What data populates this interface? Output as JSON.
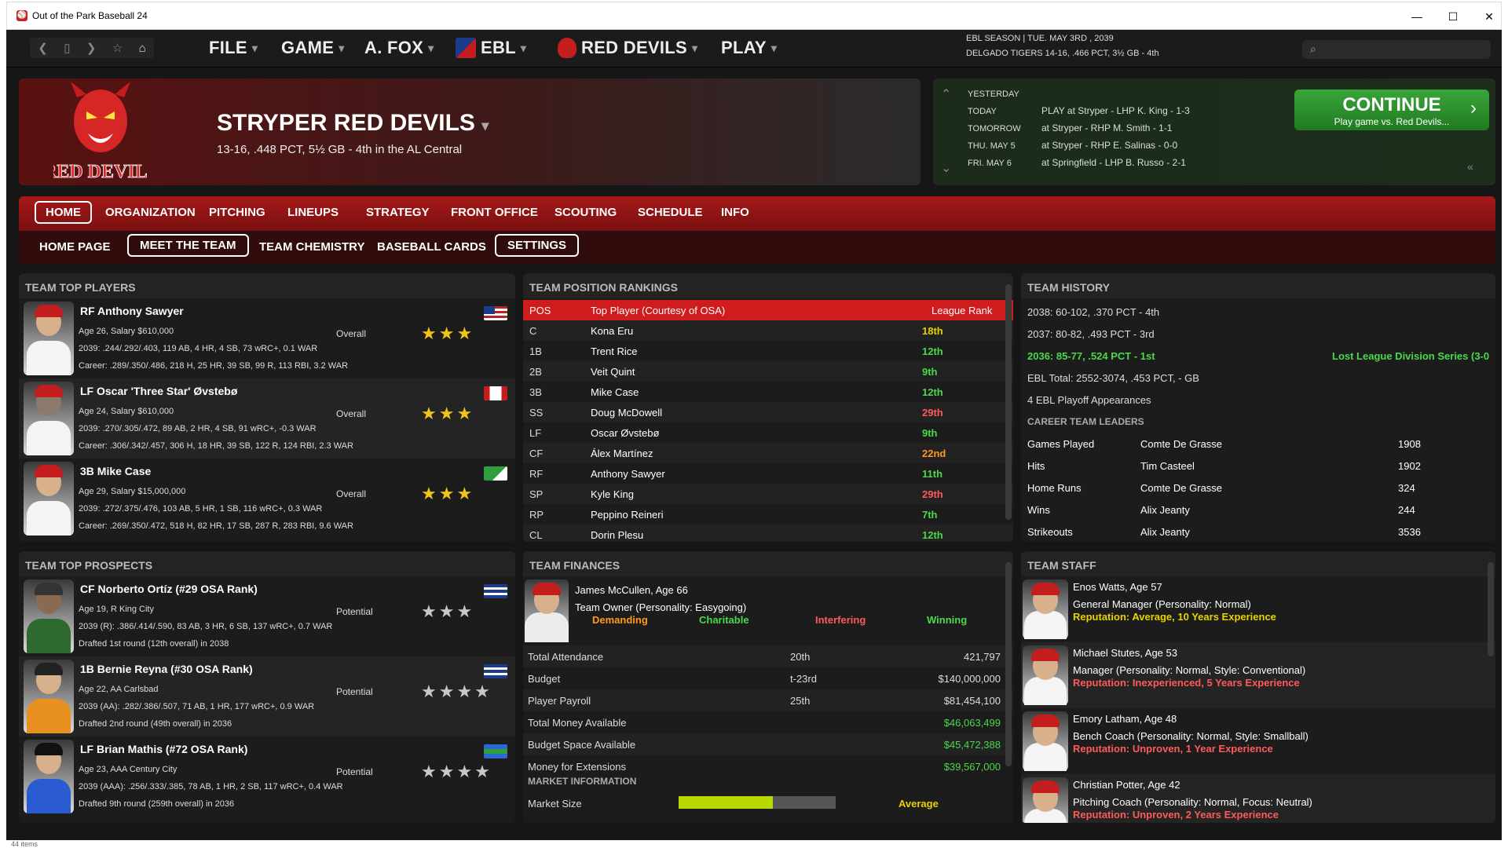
{
  "window": {
    "title": "Out of the Park Baseball 24"
  },
  "nav": {
    "menus": [
      "FILE",
      "GAME",
      "A. FOX",
      "EBL",
      "RED DEVILS",
      "PLAY"
    ],
    "season_line1": "EBL SEASON  |  TUE. MAY 3RD , 2039",
    "season_line2": "DELGADO TIGERS   14-16, .466 PCT, 3½ GB - 4th"
  },
  "team": {
    "name": "STRYPER RED DEVILS",
    "record": "13-16, .448 PCT, 5½ GB - 4th in the AL Central",
    "logo_text": "RED DEVILS",
    "brand_color": "#c41d1d"
  },
  "schedule": {
    "rows": [
      {
        "day": "YESTERDAY",
        "text": ""
      },
      {
        "day": "TODAY",
        "text": "PLAY at Stryper - LHP K. King - 1-3"
      },
      {
        "day": "TOMORROW",
        "text": "at Stryper - RHP M. Smith - 1-1"
      },
      {
        "day": "THU. MAY 5",
        "text": "at Stryper - RHP E. Salinas - 0-0"
      },
      {
        "day": "FRI. MAY 6",
        "text": "at Springfield - LHP B. Russo - 2-1"
      }
    ],
    "continue_label": "CONTINUE",
    "continue_sub": "Play game vs. Red Devils..."
  },
  "tabs": [
    "HOME",
    "ORGANIZATION",
    "PITCHING",
    "LINEUPS",
    "STRATEGY",
    "FRONT OFFICE",
    "SCOUTING",
    "SCHEDULE",
    "INFO"
  ],
  "subtabs": [
    "HOME PAGE",
    "MEET THE TEAM",
    "TEAM CHEMISTRY",
    "BASEBALL CARDS",
    "SETTINGS"
  ],
  "top_players": {
    "title": "TEAM TOP PLAYERS",
    "players": [
      {
        "name": "RF Anthony Sawyer",
        "info": "Age 26, Salary $610,000",
        "label": "Overall",
        "stars": "★★★",
        "line1": "2039: .244/.292/.403, 119 AB, 4 HR, 4 SB, 73 wRC+, 0.1 WAR",
        "line2": "Career: .289/.350/.486, 218 H, 25 HR, 39 SB, 99 R, 113 RBI, 3.2 WAR"
      },
      {
        "name": "LF Oscar 'Three Star' Øvstebø",
        "info": "Age 24, Salary $610,000",
        "label": "Overall",
        "stars": "★★★",
        "line1": "2039: .270/.305/.472, 89 AB, 2 HR, 4 SB, 91 wRC+, -0.3 WAR",
        "line2": "Career: .306/.342/.457, 306 H, 18 HR, 39 SB, 122 R, 124 RBI, 2.3 WAR"
      },
      {
        "name": "3B Mike Case",
        "info": "Age 29, Salary $15,000,000",
        "label": "Overall",
        "stars": "★★★",
        "line1": "2039: .272/.375/.476, 103 AB, 5 HR, 1 SB, 116 wRC+, 0.3 WAR",
        "line2": "Career: .269/.350/.472, 518 H, 82 HR, 17 SB, 287 R, 283 RBI, 9.6 WAR"
      }
    ]
  },
  "prospects": {
    "title": "TEAM TOP PROSPECTS",
    "players": [
      {
        "name": "CF Norberto Ortíz (#29 OSA Rank)",
        "info": "Age 19, R King City",
        "label": "Potential",
        "stars": "★★★",
        "line1": "2039 (R): .386/.414/.590, 83 AB, 3 HR, 6 SB, 137 wRC+, 0.7 WAR",
        "line2": "Drafted 1st round (12th overall) in 2038"
      },
      {
        "name": "1B Bernie Reyna (#30 OSA Rank)",
        "info": "Age 22, AA Carlsbad",
        "label": "Potential",
        "stars": "★★★★",
        "line1": "2039 (AA): .282/.386/.507, 71 AB, 1 HR, 177 wRC+, 0.9 WAR",
        "line2": "Drafted 2nd round (49th overall) in 2036"
      },
      {
        "name": "LF Brian Mathis (#72 OSA Rank)",
        "info": "Age 23, AAA Century City",
        "label": "Potential",
        "stars": "★★★★",
        "line1": "2039 (AAA): .256/.333/.385, 78 AB, 1 HR, 2 SB, 117 wRC+, 0.4 WAR",
        "line2": "Drafted 9th round (259th overall) in 2036"
      }
    ]
  },
  "rankings": {
    "title": "TEAM POSITION RANKINGS",
    "header": {
      "pos": "POS",
      "player": "Top Player (Courtesy of OSA)",
      "rank": "League Rank"
    },
    "rows": [
      {
        "pos": "C",
        "player": "Kona Eru",
        "rank": "18th",
        "color": "#e8d200"
      },
      {
        "pos": "1B",
        "player": "Trent Rice",
        "rank": "12th",
        "color": "#4bd84b"
      },
      {
        "pos": "2B",
        "player": "Veit Quint",
        "rank": "9th",
        "color": "#4bd84b"
      },
      {
        "pos": "3B",
        "player": "Mike Case",
        "rank": "12th",
        "color": "#4bd84b"
      },
      {
        "pos": "SS",
        "player": "Doug McDowell",
        "rank": "29th",
        "color": "#ff5a5a"
      },
      {
        "pos": "LF",
        "player": "Oscar Øvstebø",
        "rank": "9th",
        "color": "#4bd84b"
      },
      {
        "pos": "CF",
        "player": "Álex Martínez",
        "rank": "22nd",
        "color": "#ff9a1f"
      },
      {
        "pos": "RF",
        "player": "Anthony Sawyer",
        "rank": "11th",
        "color": "#4bd84b"
      },
      {
        "pos": "SP",
        "player": "Kyle King",
        "rank": "29th",
        "color": "#ff5a5a"
      },
      {
        "pos": "RP",
        "player": "Peppino Reineri",
        "rank": "7th",
        "color": "#4bd84b"
      },
      {
        "pos": "CL",
        "player": "Dorin Plesu",
        "rank": "12th",
        "color": "#4bd84b"
      }
    ]
  },
  "history": {
    "title": "TEAM HISTORY",
    "lines": [
      "2038: 60-102, .370 PCT - 4th",
      "2037: 80-82, .493 PCT - 3rd"
    ],
    "highlight": "2036: 85-77, .524 PCT - 1st",
    "highlight_right": "Lost League Division Series (3-0",
    "lines2": [
      "EBL Total: 2552-3074, .453 PCT, - GB",
      "4 EBL Playoff Appearances"
    ],
    "leaders_title": "CAREER TEAM LEADERS",
    "leaders": [
      {
        "stat": "Games Played",
        "name": "Comte De Grasse",
        "val": "1908"
      },
      {
        "stat": "Hits",
        "name": "Tim Casteel",
        "val": "1902"
      },
      {
        "stat": "Home Runs",
        "name": "Comte De Grasse",
        "val": "324"
      },
      {
        "stat": "Wins",
        "name": "Alix Jeanty",
        "val": "244"
      },
      {
        "stat": "Strikeouts",
        "name": "Alix Jeanty",
        "val": "3536"
      }
    ]
  },
  "finances": {
    "title": "TEAM FINANCES",
    "owner_name": "James McCullen, Age 66",
    "owner_role": "Team Owner (Personality: Easygoing)",
    "traits": [
      {
        "label": "Demanding",
        "color": "#ff9a1f"
      },
      {
        "label": "Charitable",
        "color": "#4bd84b"
      },
      {
        "label": "Interfering",
        "color": "#ff5a5a"
      },
      {
        "label": "Winning",
        "color": "#4bd84b"
      }
    ],
    "rows": [
      {
        "label": "Total Attendance",
        "rank": "20th",
        "value": "421,797",
        "green": false
      },
      {
        "label": "Budget",
        "rank": "t-23rd",
        "value": "$140,000,000",
        "green": false
      },
      {
        "label": "Player Payroll",
        "rank": "25th",
        "value": "$81,454,100",
        "green": false
      },
      {
        "label": "Total Money Available",
        "rank": "",
        "value": "$46,063,499",
        "green": true
      },
      {
        "label": "Budget Space Available",
        "rank": "",
        "value": "$45,472,388",
        "green": true
      },
      {
        "label": "Money for Extensions",
        "rank": "",
        "value": "$39,567,000",
        "green": true
      }
    ],
    "market_title": "MARKET INFORMATION",
    "market_label": "Market Size",
    "market_value": "Average",
    "market_fill": 0.6
  },
  "staff": {
    "title": "TEAM STAFF",
    "members": [
      {
        "name": "Enos Watts, Age 57",
        "role": "General Manager (Personality: Normal)",
        "rep": "Reputation: Average, 10 Years Experience",
        "rep_color": "#e8d200"
      },
      {
        "name": "Michael Stutes, Age 53",
        "role": "Manager (Personality: Normal, Style: Conventional)",
        "rep": "Reputation: Inexperienced, 5 Years Experience",
        "rep_color": "#ff5a5a"
      },
      {
        "name": "Emory Latham, Age 48",
        "role": "Bench Coach (Personality: Normal, Style: Smallball)",
        "rep": "Reputation: Unproven, 1 Year Experience",
        "rep_color": "#ff5a5a"
      },
      {
        "name": "Christian Potter, Age 42",
        "role": "Pitching Coach (Personality: Normal, Focus: Neutral)",
        "rep": "Reputation: Unproven, 2 Years Experience",
        "rep_color": "#ff5a5a"
      }
    ]
  },
  "status": {
    "items": "44 items"
  }
}
